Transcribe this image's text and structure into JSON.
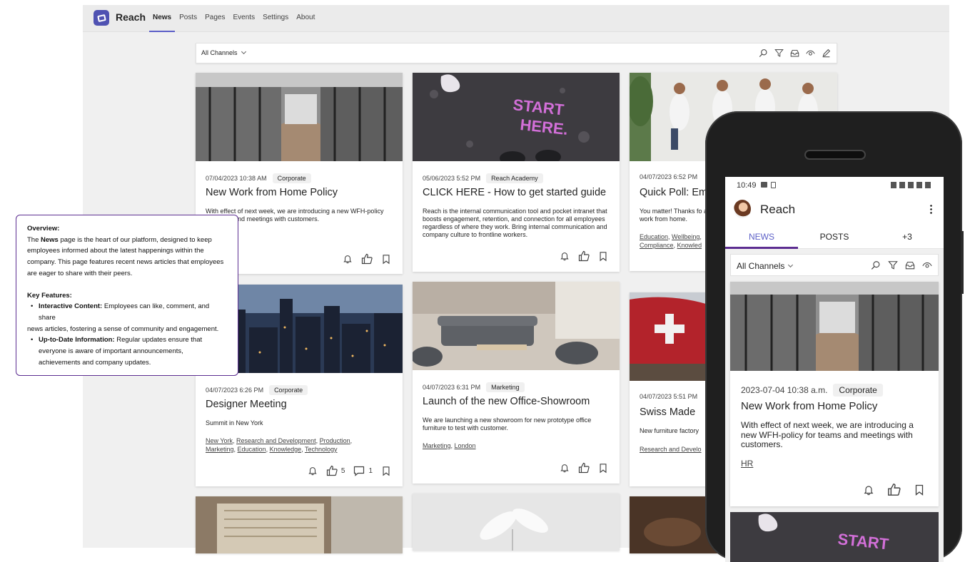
{
  "app": {
    "name": "Reach",
    "nav": [
      "News",
      "Posts",
      "Pages",
      "Events",
      "Settings",
      "About"
    ],
    "active_nav": "News"
  },
  "filter": {
    "channel": "All Channels"
  },
  "cards": [
    {
      "timestamp": "07/04/2023 10:38 AM",
      "category": "Corporate",
      "title": "New Work from Home Policy",
      "body": "With effect of next week, we are introducing a new WFH-policy for teams and meetings with customers.",
      "tags": []
    },
    {
      "timestamp": "05/06/2023 5:52 PM",
      "category": "Reach Academy",
      "title": "CLICK HERE - How to get started guide",
      "body": "Reach is the internal communication tool and pocket intranet that boosts engagement, retention, and connection for all employees regardless of where they work. Bring internal communication and company culture to frontline workers.",
      "tags": []
    },
    {
      "timestamp": "04/07/2023 6:52 PM",
      "category": "",
      "title": "Quick Poll: Emp",
      "body": "You matter! Thanks fo all work from home.",
      "tags": [
        "Education",
        "Wellbeing",
        "Compliance",
        "Knowled"
      ]
    },
    {
      "timestamp": "04/07/2023 6:26 PM",
      "category": "Corporate",
      "title": "Designer Meeting",
      "body": "Summit in New York",
      "tags": [
        "New York",
        "Research and Development",
        "Production",
        "Marketing",
        "Education",
        "Knowledge",
        "Technology"
      ],
      "likes": "5",
      "comments": "1"
    },
    {
      "timestamp": "04/07/2023 6:31 PM",
      "category": "Marketing",
      "title": "Launch of the new Office-Showroom",
      "body": "We are launching a new showroom for new prototype office furniture to test with customer.",
      "tags": [
        "Marketing",
        "London"
      ]
    },
    {
      "timestamp": "04/07/2023 5:51 PM",
      "category": "",
      "title": "Swiss Made",
      "body": "New furniture factory",
      "tags": [
        "Research and Develo"
      ]
    }
  ],
  "overview": {
    "heading": "Overview:",
    "text_pre": "The ",
    "text_bold": "News",
    "text_post": " page is the heart of our platform, designed to keep employees informed about the latest happenings within the company. This page features recent news articles that employees are eager to share with their peers.",
    "features_heading": "Key Features:",
    "feature1_title": "Interactive Content:",
    "feature1_text": " Employees can like, comment, and share",
    "feature1_cont": "news articles, fostering a sense of community and engagement.",
    "feature2_title": "Up-to-Date Information:",
    "feature2_text": " Regular updates ensure that everyone is aware of important announcements, achievements and company updates."
  },
  "mobile": {
    "time": "10:49",
    "title": "Reach",
    "tabs": [
      "NEWS",
      "POSTS",
      "+3"
    ],
    "channel": "All Channels",
    "card": {
      "timestamp": "2023-07-04 10:38 a.m.",
      "category": "Corporate",
      "title": "New Work from Home Policy",
      "body": "With effect of next week, we are introducing a new WFH-policy for teams and meetings with customers.",
      "tag": "HR"
    }
  },
  "icons": [
    "search-icon",
    "filter-icon",
    "inbox-icon",
    "eye-icon",
    "edit-icon",
    "bell-icon",
    "like-icon",
    "bookmark-icon",
    "comment-icon",
    "more-icon"
  ],
  "colors": {
    "brand": "#5b5fc7",
    "accent": "#5c2d91"
  }
}
